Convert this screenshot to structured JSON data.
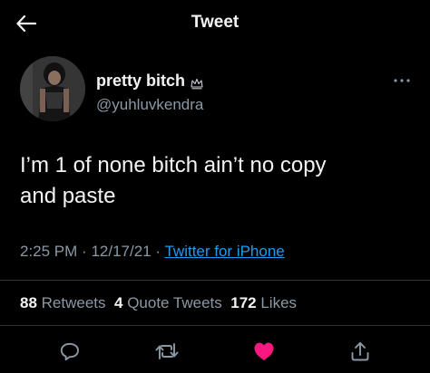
{
  "header": {
    "title": "Tweet",
    "back_icon": "arrow-left-icon"
  },
  "author": {
    "display_name": "pretty bitch",
    "badge_icon": "crown-emoji-icon",
    "handle": "@yuhluvkendra"
  },
  "tweet": {
    "text_line1": "I’m 1 of none bitch ain’t no copy",
    "text_line2": "and paste",
    "time": "2:25 PM",
    "separator": "·",
    "date": "12/17/21",
    "source": "Twitter for iPhone"
  },
  "stats": {
    "retweets_count": "88",
    "retweets_label": "Retweets",
    "quote_count": "4",
    "quote_label": "Quote Tweets",
    "likes_count": "172",
    "likes_label": "Likes"
  },
  "actions": {
    "reply_icon": "reply-icon",
    "retweet_icon": "retweet-icon",
    "like_icon": "heart-icon",
    "share_icon": "share-icon",
    "liked": true
  },
  "colors": {
    "background": "#000000",
    "text": "#f2f3f4",
    "secondary": "#8b98a5",
    "link": "#1d9bf0",
    "like": "#f91880",
    "divider": "#2f3336"
  }
}
